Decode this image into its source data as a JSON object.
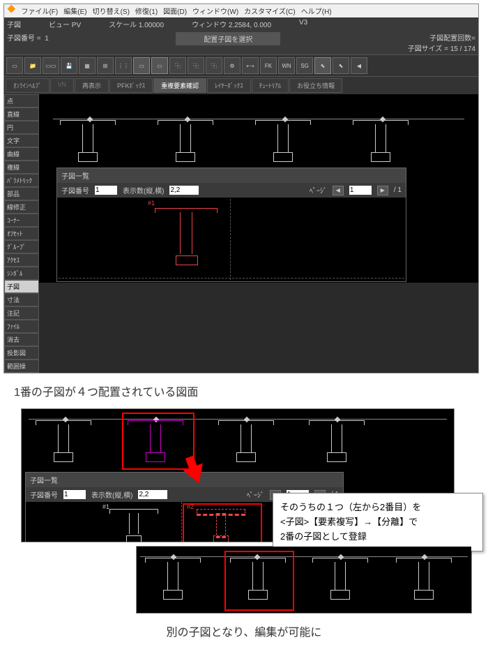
{
  "menu": {
    "file": "ファイル(F)",
    "edit": "編集(E)",
    "switch": "切り替え(S)",
    "repair": "修復(1)",
    "figure": "図面(D)",
    "window": "ウィンドウ(W)",
    "customize": "カスタマイズ(C)",
    "help": "ヘルプ(H)"
  },
  "info": {
    "child": "子図",
    "view": "ビュー PV",
    "scale": "スケール 1.00000",
    "window": "ウィンドウ 2.2584, 0.000",
    "v3": "V3"
  },
  "info2": {
    "childno": "子図番号 =",
    "childno_v": "1",
    "title": "配置子図を選択",
    "count": "子図配置回数=",
    "size": "子図サイズ =",
    "sizeval": "15 /   174"
  },
  "tool": {
    "fk": "FK",
    "wn": "WN",
    "sg": "SG"
  },
  "cmd": {
    "online": "ｵﾝﾗｲﾝﾍﾙﾌﾟ",
    "vn": "VN",
    "redraw": "再表示",
    "pfk": "PFKﾎﾞｯｸｽ",
    "param": "重複要素確認",
    "layer": "ﾚｲﾔｰﾎﾞｯｸｽ",
    "tutorial": "ﾁｭｰﾄﾘｱﾙ",
    "useful": "お役立ち情報"
  },
  "side": [
    "点",
    "直線",
    "円",
    "文字",
    "曲線",
    "複線",
    "ﾊﾟﾗﾒﾄﾘｯｸ",
    "部品",
    "線修正",
    "ｺｰﾅｰ",
    "ｵﾌｾｯﾄ",
    "ｸﾞﾙｰﾌﾟ",
    "ｱｸｾｽ",
    "ｼﾝﾎﾞﾙ",
    "子図",
    "寸法",
    "注記",
    "ﾌｧｲﾙ",
    "消去",
    "投影図",
    "範囲操"
  ],
  "list": {
    "title": "子図一覧",
    "numlabel": "子図番号",
    "num": "1",
    "displabel": "表示数(縦,横)",
    "disp": "2,2",
    "pglabel": "ﾍﾟｰｼﾞ",
    "pg": "1",
    "pgtotal": "/  1",
    "tag1": "#1",
    "tag2": "#2"
  },
  "caption1": "1番の子図が４つ配置されている図面",
  "callout": "そのうちの１つ（左から2番目）を\n<子図>【要素複写】→【分離】で\n2番の子図として登録",
  "caption2": "別の子図となり、編集が可能に"
}
